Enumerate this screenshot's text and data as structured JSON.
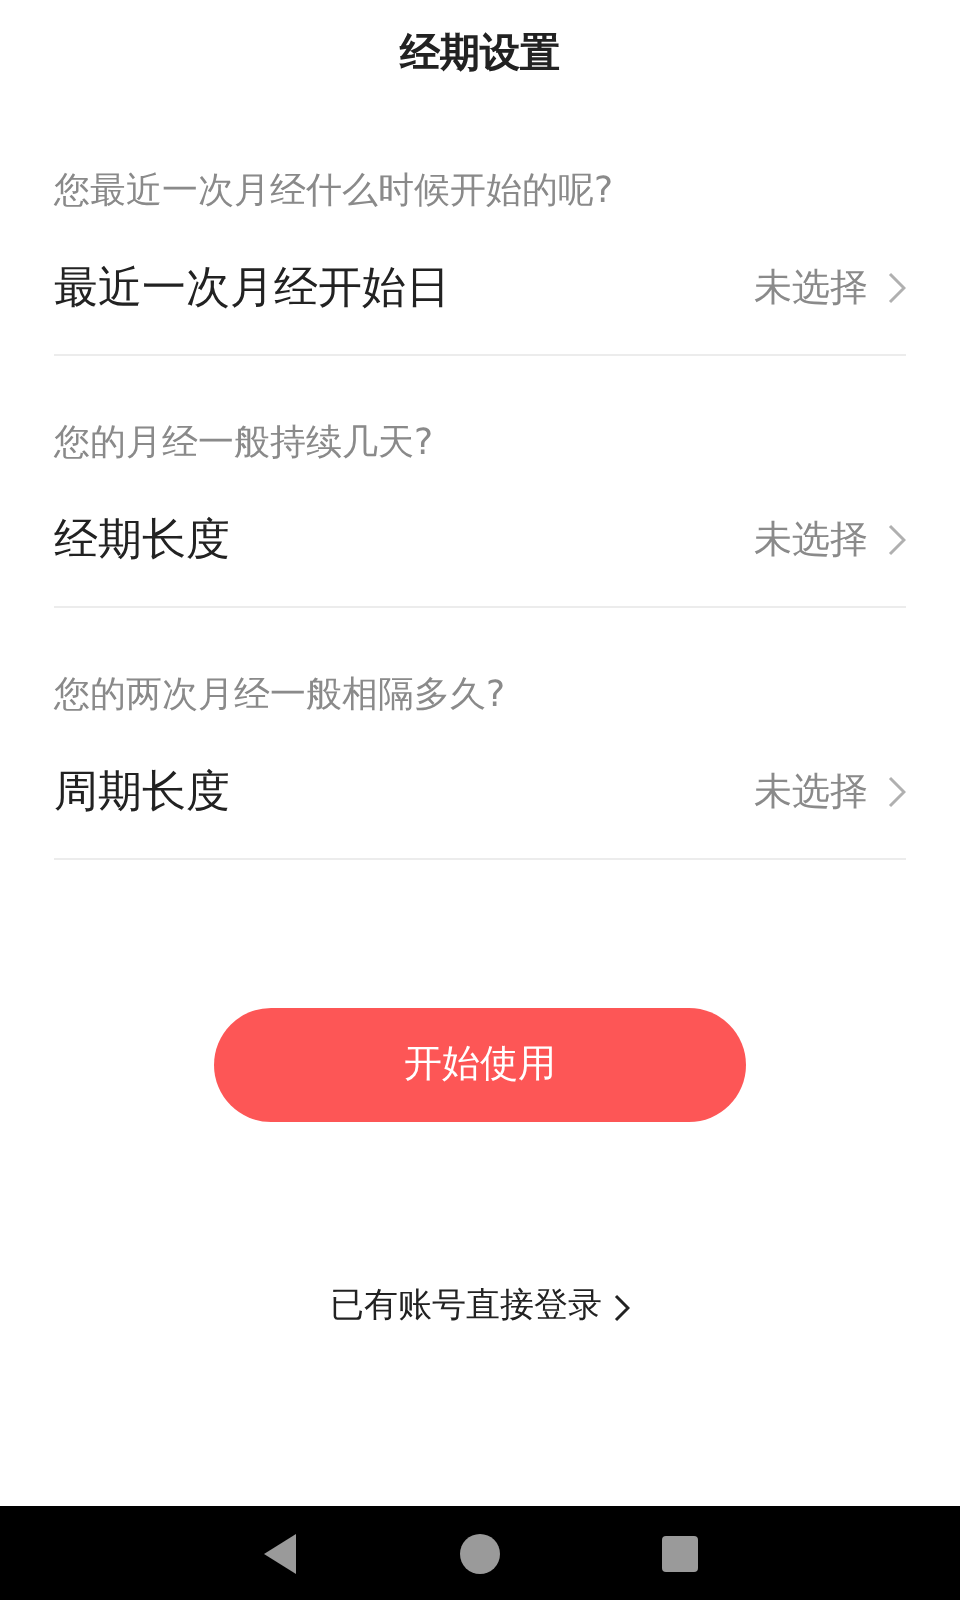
{
  "title": "经期设置",
  "settings": [
    {
      "question": "您最近一次月经什么时候开始的呢?",
      "label": "最近一次月经开始日",
      "value": "未选择"
    },
    {
      "question": "您的月经一般持续几天?",
      "label": "经期长度",
      "value": "未选择"
    },
    {
      "question": "您的两次月经一般相隔多久?",
      "label": "周期长度",
      "value": "未选择"
    }
  ],
  "start_button": "开始使用",
  "login_link": "已有账号直接登录"
}
